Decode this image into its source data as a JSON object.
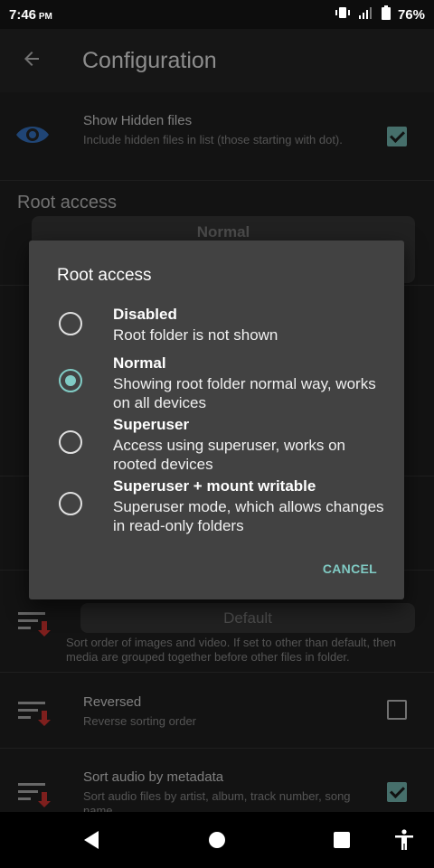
{
  "status_bar": {
    "time": "7:46",
    "ampm": "PM",
    "battery": "76%",
    "icons": [
      "vibrate-icon",
      "signal-icon",
      "battery-icon"
    ]
  },
  "app_bar": {
    "title": "Configuration",
    "back_icon": "arrow-left-icon"
  },
  "settings": {
    "show_hidden": {
      "title": "Show Hidden files",
      "subtitle": "Include hidden files in list (those starting with dot).",
      "checked": true
    },
    "root_access_section": "Root access",
    "root_access_value": "Normal",
    "sort_media_value": "Default",
    "sort_media_subtitle": "Sort order of images and video. If set to other than default, then media are grouped together before other files in folder.",
    "reversed": {
      "title": "Reversed",
      "subtitle": "Reverse sorting order",
      "checked": false
    },
    "sort_audio": {
      "title": "Sort audio by metadata",
      "subtitle": "Sort audio files by artist, album, track number, song name",
      "checked": true
    }
  },
  "dialog": {
    "title": "Root access",
    "options": [
      {
        "title": "Disabled",
        "subtitle": "Root folder is not shown",
        "selected": false
      },
      {
        "title": "Normal",
        "subtitle": "Showing root folder normal way, works on all devices",
        "selected": true
      },
      {
        "title": "Superuser",
        "subtitle": "Access using superuser, works on rooted devices",
        "selected": false
      },
      {
        "title": "Superuser + mount writable",
        "subtitle": "Superuser mode, which allows changes in read-only folders",
        "selected": false
      }
    ],
    "cancel_label": "CANCEL"
  },
  "colors": {
    "accent": "#80cbc4",
    "background": "#232323",
    "dialog": "#424242",
    "sort_arrow": "#e53935"
  }
}
